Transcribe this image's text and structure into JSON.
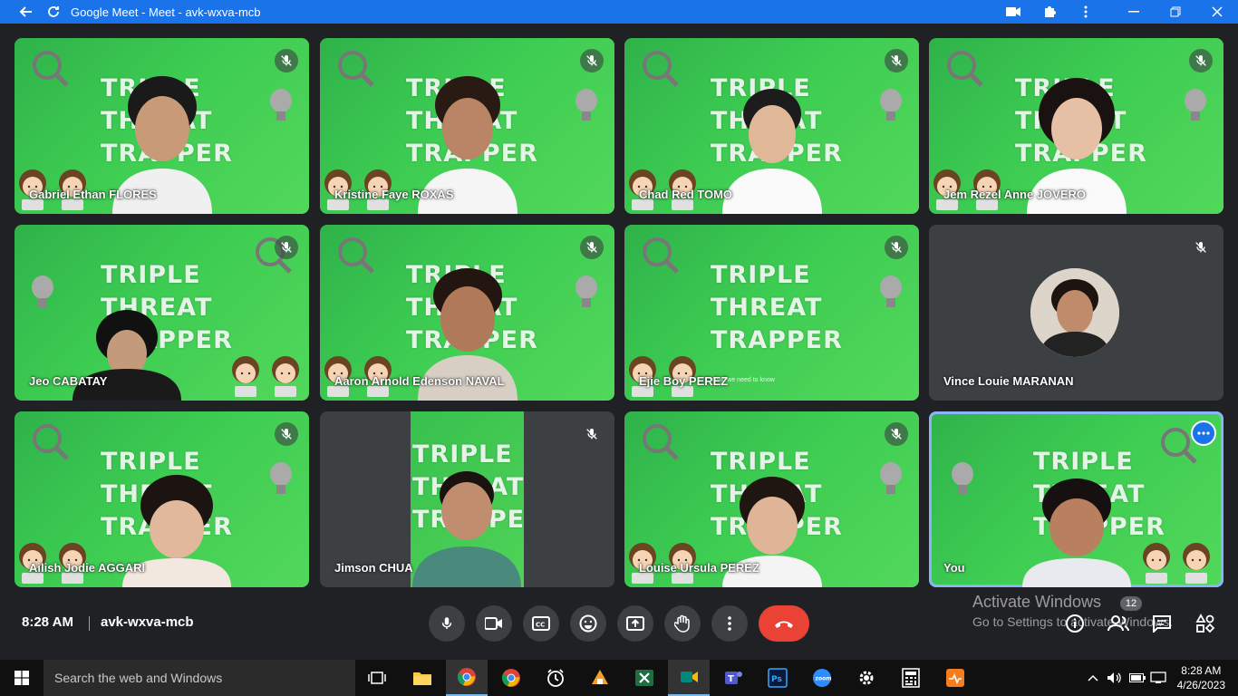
{
  "window": {
    "title": "Google Meet - Meet - avk-wxva-mcb"
  },
  "background": {
    "line1": "TRIPLE",
    "line2": "THREAT",
    "line3": "TRAPPER",
    "tagline": "What we need to know"
  },
  "participants": [
    {
      "name": "Gabriel Ethan FLORES"
    },
    {
      "name": "Kristine Faye ROXAS"
    },
    {
      "name": "Chad Red TOMO"
    },
    {
      "name": "Jem Rezel Anne JOVERO"
    },
    {
      "name": "Jeo CABATAY"
    },
    {
      "name": "Aaron Arnold Edenson NAVAL"
    },
    {
      "name": "Ejie Boy PEREZ"
    },
    {
      "name": "Vince Louie MARANAN"
    },
    {
      "name": "Ailish Jodie AGGARI"
    },
    {
      "name": "Jimson CHUA"
    },
    {
      "name": "Louise Ursula PEREZ"
    },
    {
      "name": "You"
    }
  ],
  "meeting": {
    "time": "8:28 AM",
    "code": "avk-wxva-mcb",
    "people_count": "12"
  },
  "watermark": {
    "title": "Activate Windows",
    "subtitle": "Go to Settings to activate Windows."
  },
  "taskbar": {
    "search_placeholder": "Search the web and Windows",
    "time": "8:28 AM",
    "date": "4/26/2023"
  },
  "colors": {
    "titlebar": "#1a73e8",
    "end_call": "#ea4335",
    "tile_green": "#3dcc52"
  }
}
